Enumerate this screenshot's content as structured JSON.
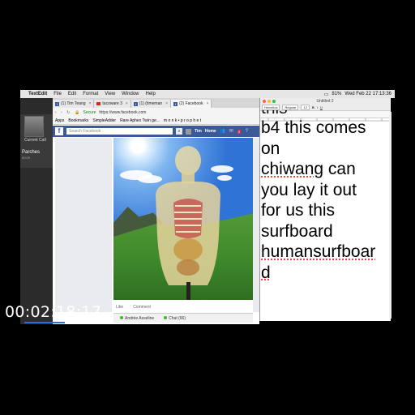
{
  "menubar": {
    "app": "TextEdit",
    "items": [
      "File",
      "Edit",
      "Format",
      "View",
      "Window",
      "Help"
    ],
    "clock": "Wed Feb 22  17:13:36",
    "battery": "81%"
  },
  "call": {
    "camera_label": "Current Call",
    "caller_name": "Parches",
    "caller_sub": "00:29"
  },
  "browser": {
    "tabs": [
      {
        "label": "(1) Tim Teang",
        "icon": "facebook-icon"
      },
      {
        "label": "tacoware 3",
        "icon": "youtube-icon"
      },
      {
        "label": "(1) (timeman",
        "icon": "facebook-icon"
      },
      {
        "label": "(2) Facebook",
        "icon": "facebook-icon"
      }
    ],
    "secure_label": "Secure",
    "url": "https://www.facebook.com",
    "bookmarks": [
      "Apps",
      "Bookmarks",
      "SimpleAdder",
      "Rare Aphex Twin ge...",
      "m o n k • p r o p h e t"
    ]
  },
  "facebook": {
    "search_placeholder": "Search Facebook",
    "user": "Tim",
    "home": "Home",
    "notifications": "2",
    "like": "Like",
    "comment": "Comment",
    "chat_contact": "Andrée Asseline",
    "chat_label": "Chat (66)"
  },
  "textedit": {
    "title": "Untitled 2",
    "font_family_box": "Helvetica",
    "font_style_box": "Regular",
    "font_size_box": "12",
    "top_fragment": "this",
    "lines": [
      {
        "text": "b4 this comes",
        "misspelled": false
      },
      {
        "text": "on",
        "misspelled": false
      },
      {
        "text": "chiwang",
        "misspelled": true,
        "rest": " can"
      },
      {
        "text": "you lay it out",
        "misspelled": false
      },
      {
        "text": "for us this",
        "misspelled": false
      },
      {
        "text": "surfboard",
        "misspelled": false
      },
      {
        "text": "humansurfboar",
        "misspelled": true
      },
      {
        "text": "d",
        "misspelled": true
      }
    ]
  },
  "timecode": "00:02:18;17"
}
